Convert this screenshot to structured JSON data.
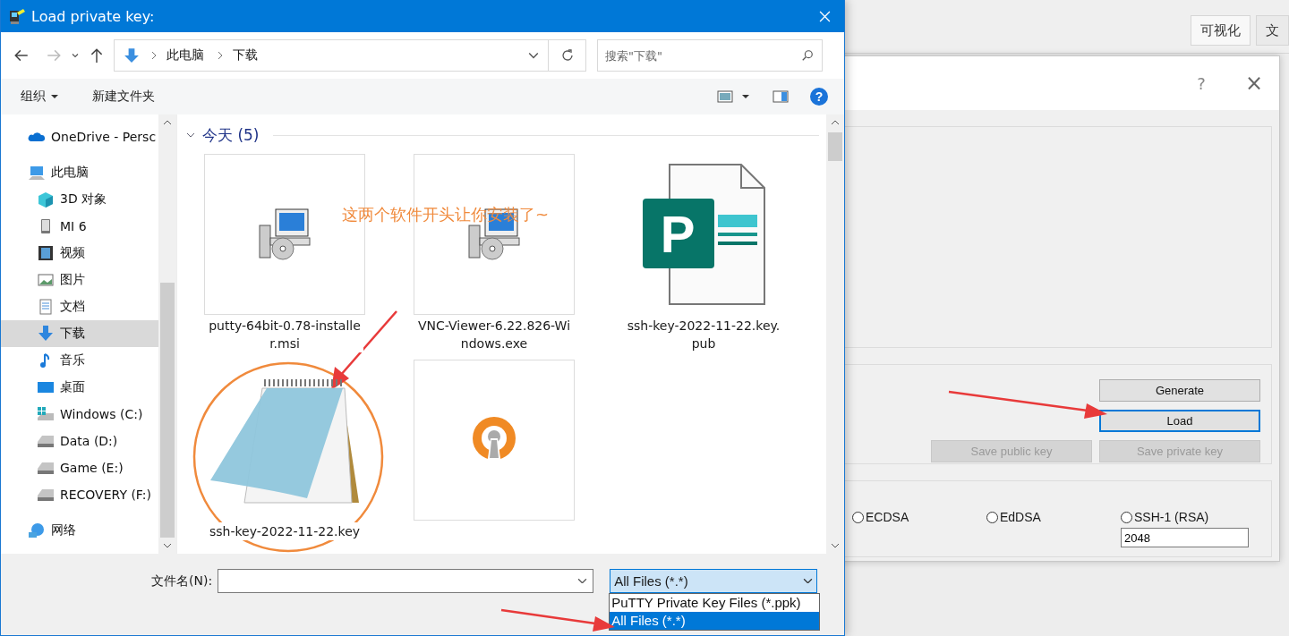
{
  "background_app": {
    "tabs": [
      {
        "label": "可视化",
        "selected": true
      },
      {
        "label": "文",
        "selected": false
      }
    ],
    "keygen": {
      "help": "?",
      "close": "×",
      "button_rows": [
        [
          {
            "label": "Generate",
            "focused": false,
            "disabled": false
          }
        ],
        [
          {
            "label": "Load",
            "focused": true,
            "disabled": false
          }
        ],
        [
          {
            "label": "Save public key",
            "focused": false,
            "disabled": true
          },
          {
            "label": "Save private key",
            "focused": false,
            "disabled": true
          }
        ]
      ],
      "key_types": [
        {
          "label": "ECDSA",
          "selected": false
        },
        {
          "label": "EdDSA",
          "selected": false
        },
        {
          "label": "SSH-1 (RSA)",
          "selected": false
        }
      ],
      "bits": "2048"
    }
  },
  "dialog": {
    "title": "Load private key:",
    "breadcrumb": [
      "此电脑",
      "下载"
    ],
    "search": {
      "placeholder": "搜索\"下载\""
    },
    "help": "?",
    "toolbar": [
      {
        "label": "组织",
        "menu": true
      },
      {
        "label": "新建文件夹",
        "menu": false
      }
    ],
    "nav": [
      {
        "label": "OneDrive - Persc",
        "kind": "cloud",
        "selected": false
      },
      {
        "label": "此电脑",
        "kind": "computer",
        "selected": false,
        "children": [
          {
            "label": "3D 对象",
            "kind": "cube",
            "selected": false
          },
          {
            "label": "MI 6",
            "kind": "phone",
            "selected": false
          },
          {
            "label": "视频",
            "kind": "video",
            "selected": false
          },
          {
            "label": "图片",
            "kind": "picture",
            "selected": false
          },
          {
            "label": "文档",
            "kind": "document",
            "selected": false
          },
          {
            "label": "下载",
            "kind": "download",
            "selected": true
          },
          {
            "label": "音乐",
            "kind": "music",
            "selected": false
          },
          {
            "label": "桌面",
            "kind": "desktop",
            "selected": false
          },
          {
            "label": "Windows (C:)",
            "kind": "system-drive",
            "selected": false
          },
          {
            "label": "Data (D:)",
            "kind": "drive",
            "selected": false
          },
          {
            "label": "Game (E:)",
            "kind": "drive",
            "selected": false
          },
          {
            "label": "RECOVERY (F:)",
            "kind": "drive",
            "selected": false
          }
        ]
      },
      {
        "label": "网络",
        "kind": "network",
        "selected": false
      }
    ],
    "group": {
      "label": "今天 (5)",
      "expanded": true
    },
    "files": [
      {
        "name": "putty-64bit-0.78-installer.msi",
        "kind": "installer"
      },
      {
        "name": "VNC-Viewer-6.22.826-Windows.exe",
        "kind": "installer"
      },
      {
        "name": "ssh-key-2022-11-22.key.pub",
        "kind": "publisher",
        "icon_letter": "P"
      },
      {
        "name": "ssh-key-2022-11-22.key",
        "kind": "notepad"
      },
      {
        "kind": "vpn"
      }
    ],
    "filename": {
      "label": "文件名(N):"
    },
    "filter": {
      "value": "All Files (*.*)",
      "options": [
        {
          "label": "PuTTY Private Key Files (*.ppk)",
          "selected": false
        },
        {
          "label": "All Files (*.*)",
          "selected": true
        }
      ]
    }
  },
  "annotation": {
    "note": "这两个软件开头让你安装了~"
  }
}
